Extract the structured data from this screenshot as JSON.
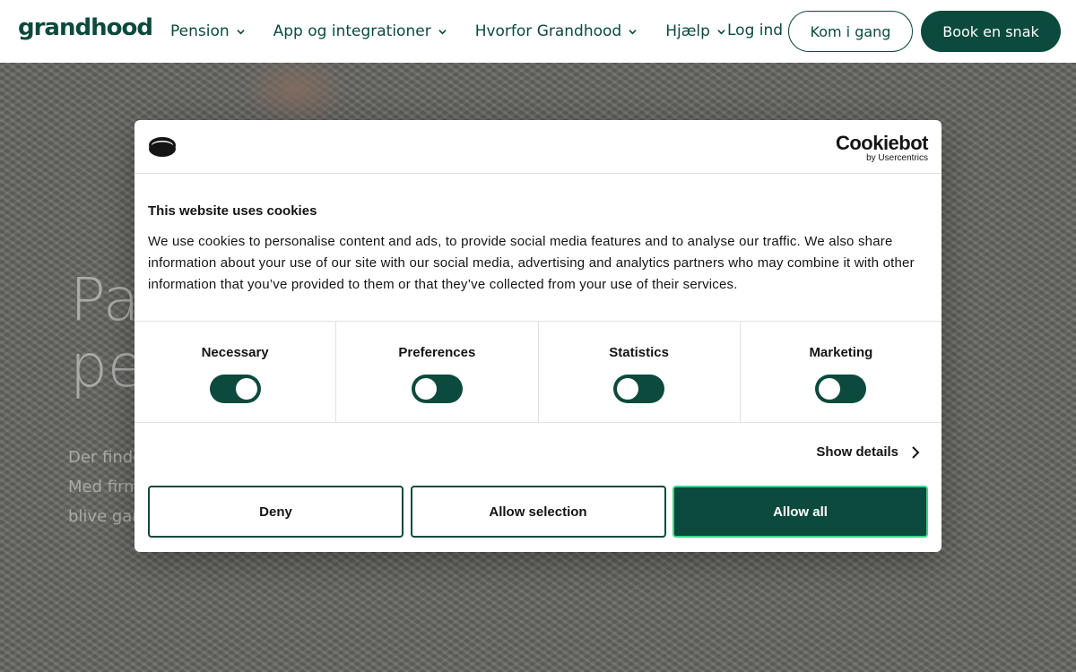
{
  "header": {
    "logo": "grandhood",
    "nav": [
      {
        "label": "Pension"
      },
      {
        "label": "App og integrationer"
      },
      {
        "label": "Hvorfor Grandhood"
      },
      {
        "label": "Hjælp"
      }
    ],
    "login": "Log ind",
    "get_started": "Kom i gang",
    "book": "Book en snak"
  },
  "hero": {
    "title": "Pa\npe",
    "text": "Der finde\nMed firm\nblive gan"
  },
  "cookie_dialog": {
    "brand": "Cookiebot",
    "brand_sub": "by Usercentrics",
    "title": "This website uses cookies",
    "text": "We use cookies to personalise content and ads, to provide social media features and to analyse our traffic. We also share information about your use of our site with our social media, advertising and analytics partners who may combine it with other information that you’ve provided to them or that they’ve collected from your use of their services.",
    "toggles": [
      {
        "label": "Necessary",
        "state": "on"
      },
      {
        "label": "Preferences",
        "state": "off"
      },
      {
        "label": "Statistics",
        "state": "off"
      },
      {
        "label": "Marketing",
        "state": "off"
      }
    ],
    "show_details": "Show details",
    "buttons": {
      "deny": "Deny",
      "allow_selection": "Allow selection",
      "allow_all": "Allow all"
    }
  },
  "colors": {
    "brand_green": "#0b4a3c",
    "accent_border": "#3fd48a"
  }
}
